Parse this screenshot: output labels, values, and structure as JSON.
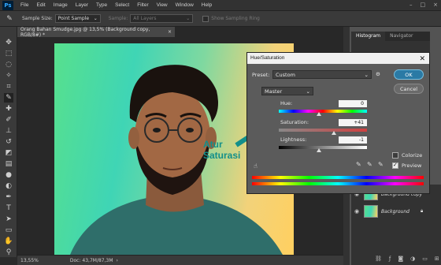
{
  "app": {
    "logo": "Ps"
  },
  "menu": [
    "File",
    "Edit",
    "Image",
    "Layer",
    "Type",
    "Select",
    "Filter",
    "View",
    "Window",
    "Help"
  ],
  "options": {
    "sample_size_label": "Sample Size:",
    "sample_size_value": "Point Sample",
    "sample_label": "Sample:",
    "sample_value": "All Layers",
    "show_ring_label": "Show Sampling Ring"
  },
  "document": {
    "tab_title": "Orang Bahan Smudge.jpg @ 13,5% (Background copy, RGB/8#) *",
    "zoom": "13,55%",
    "doc_info": "Doc: 43,7M/87,3M"
  },
  "panels": {
    "histogram_tab": "Histogram",
    "navigator_tab": "Navigator",
    "layer_copy_name": "Background copy",
    "layer_bg_name": "Background"
  },
  "dialog": {
    "title": "Hue/Saturation",
    "preset_label": "Preset:",
    "preset_value": "Custom",
    "ok_label": "OK",
    "cancel_label": "Cancel",
    "channel_value": "Master",
    "hue_label": "Hue:",
    "hue_value": "0",
    "saturation_label": "Saturation:",
    "saturation_value": "+41",
    "lightness_label": "Lightness:",
    "lightness_value": "-1",
    "colorize_label": "Colorize",
    "preview_label": "Preview",
    "colorize_checked": false,
    "preview_checked": true
  },
  "annotation": {
    "line1": "Atur",
    "line2": "Saturasi",
    "color": "#138f8a"
  }
}
